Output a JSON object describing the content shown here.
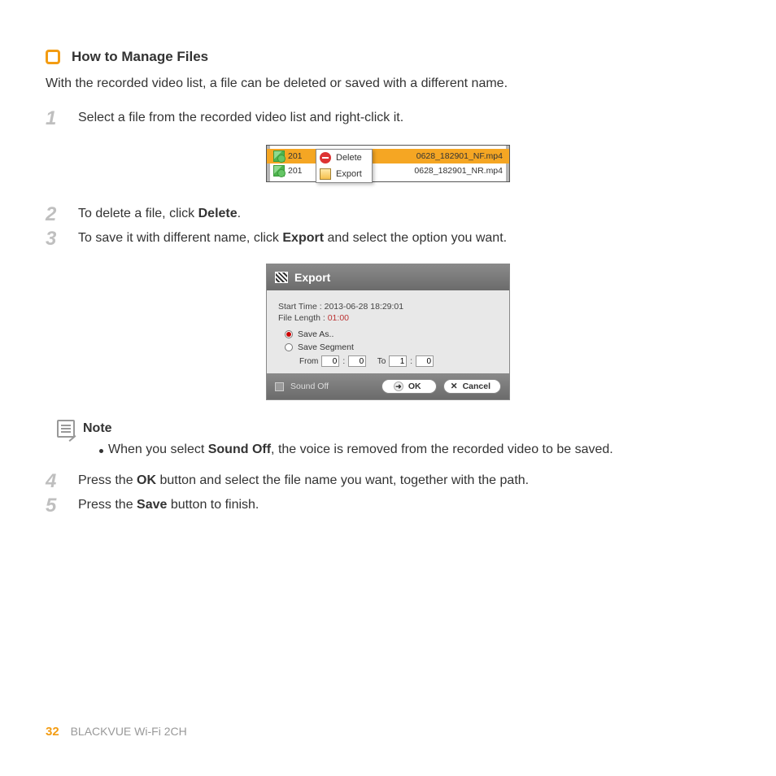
{
  "heading": "How to Manage Files",
  "intro": "With the recorded video list, a file can be deleted or saved with a different name.",
  "steps": {
    "s1": "Select a file from the recorded video list and right-click it.",
    "s2_a": "To delete a file, click ",
    "s2_b": "Delete",
    "s2_c": ".",
    "s3_a": "To save it with different name, click ",
    "s3_b": "Export",
    "s3_c": " and select the option you want.",
    "s4_a": "Press the ",
    "s4_b": "OK",
    "s4_c": " button and select the file name you want, together with the path.",
    "s5_a": "Press the ",
    "s5_b": "Save",
    "s5_c": " button to finish."
  },
  "filelist": {
    "row0_pre": "201",
    "row0_post": "0628_182901_NF.mp4",
    "row1_pre": "201",
    "row1_post": "0628_182901_NR.mp4",
    "menu": {
      "delete": "Delete",
      "export": "Export"
    }
  },
  "export": {
    "title": "Export",
    "start_label": "Start Time :",
    "start_val": "2013-06-28 18:29:01",
    "len_label": "File Length :",
    "len_val": "01:00",
    "opt_saveas": "Save As..",
    "opt_segment": "Save Segment",
    "from": "From",
    "to": "To",
    "from_m": "0",
    "from_s": "0",
    "to_m": "1",
    "to_s": "0",
    "soundoff": "Sound Off",
    "ok": "OK",
    "cancel": "Cancel"
  },
  "note": {
    "label": "Note",
    "text_a": "When you select ",
    "text_b": "Sound Off",
    "text_c": ", the voice is removed from the recorded video to be saved."
  },
  "footer": {
    "page": "32",
    "book": "BLACKVUE Wi-Fi 2CH"
  }
}
